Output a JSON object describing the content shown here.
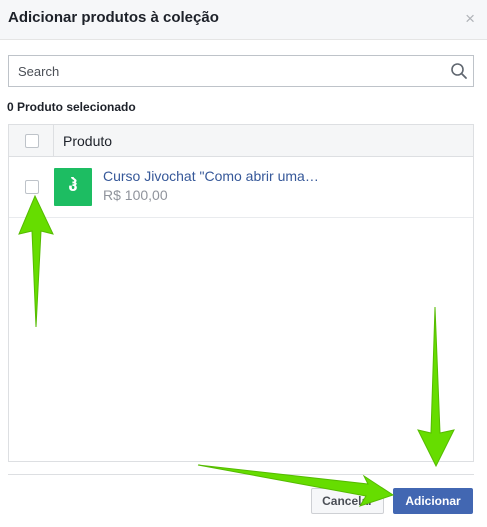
{
  "dialog": {
    "title": "Adicionar produtos à coleção",
    "close_label": "×"
  },
  "search": {
    "placeholder": "Search",
    "icon": "search-icon"
  },
  "selection": {
    "count_label": "0 Produto selecionado"
  },
  "table": {
    "column_header": "Produto",
    "rows": [
      {
        "name": "Curso Jivochat \"Como abrir uma…",
        "price": "R$ 100,00",
        "thumb_glyph": "ჰ",
        "thumb_color": "#1dbd62",
        "checked": false
      }
    ]
  },
  "footer": {
    "cancel_label": "Cancelar",
    "add_label": "Adicionar"
  },
  "colors": {
    "accent": "#4267b2",
    "link": "#365899",
    "annotation_arrow": "#66dd00"
  }
}
